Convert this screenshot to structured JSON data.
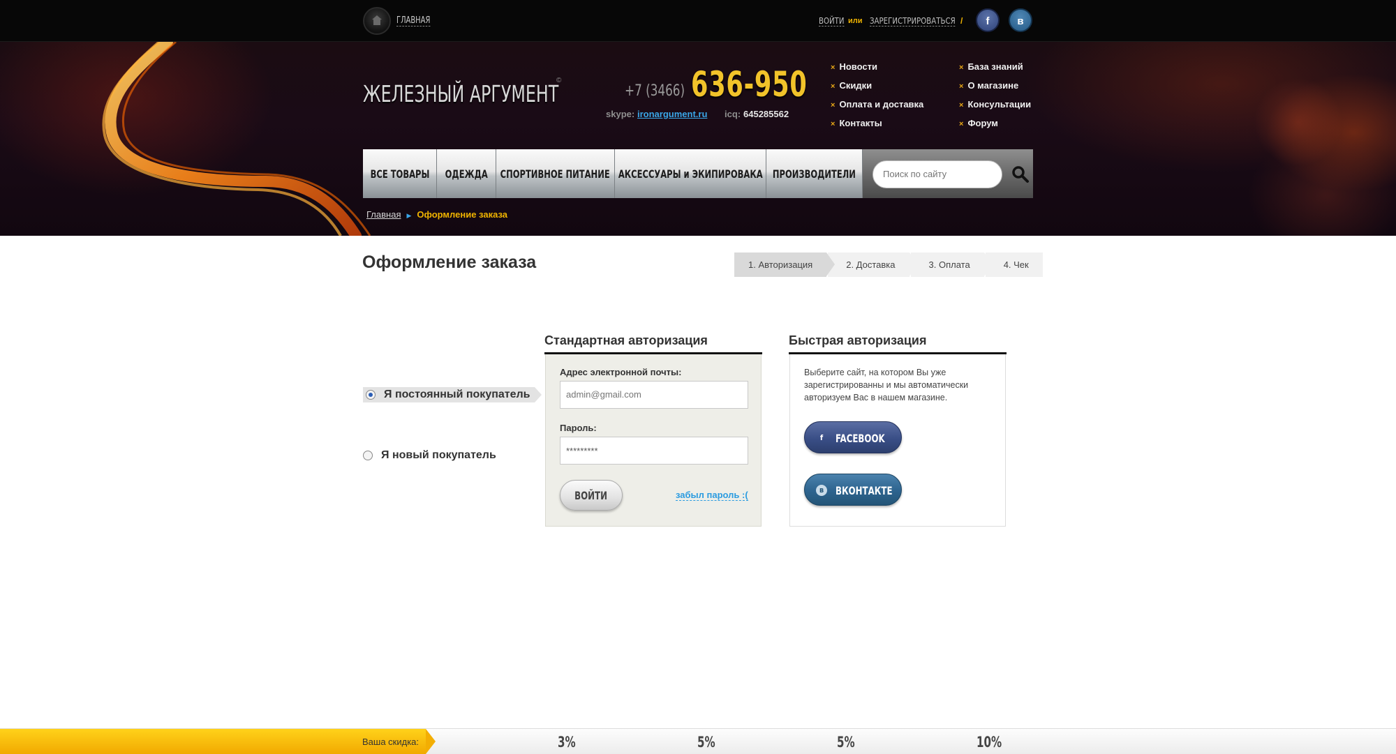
{
  "topbar": {
    "home_label": "ГЛАВНАЯ",
    "login_label": "ВОЙТИ",
    "or_label": "или",
    "register_label": "ЗАРЕГИСТРИРОВАТЬСЯ",
    "slash": "/",
    "facebook_glyph": "f",
    "vk_glyph": "в"
  },
  "header": {
    "logo": "ЖЕЛЕЗНЫЙ АРГУМЕНТ",
    "logo_reg": "©",
    "phone_code": "+7 (3466)",
    "phone_number": "636-950",
    "skype_label": "skype:",
    "skype_value": "ironargument.ru",
    "icq_label": "icq:",
    "icq_value": "645285562",
    "nav_col1": [
      "Новости",
      "Скидки",
      "Оплата и доставка",
      "Контакты"
    ],
    "nav_col2": [
      "База знаний",
      "О магазине",
      "Консультации",
      "Форум"
    ],
    "nav_marker": "×"
  },
  "menu": {
    "items": [
      "ВСЕ ТОВАРЫ",
      "ОДЕЖДА",
      "СПОРТИВНОЕ ПИТАНИЕ",
      "АКСЕССУАРЫ и ЭКИПИРОВАКА",
      "ПРОИЗВОДИТЕЛИ"
    ],
    "search_placeholder": "Поиск по сайту"
  },
  "breadcrumb": {
    "home": "Главная",
    "arrow": "▶",
    "current": "Оформление заказа"
  },
  "page": {
    "title": "Оформление заказа",
    "steps": [
      "1. Авторизация",
      "2. Доставка",
      "3. Оплата",
      "4. Чек"
    ],
    "active_step": 0
  },
  "customer_type": {
    "returning": "Я постоянный покупатель",
    "new": "Я новый покупатель",
    "selected": "returning"
  },
  "standard_auth": {
    "title": "Стандартная авторизация",
    "email_label": "Адрес электронной почты:",
    "email_placeholder": "admin@gmail.com",
    "password_label": "Пароль:",
    "password_value": "*********",
    "login_button": "ВОЙТИ",
    "forgot_link": "забыл пароль :("
  },
  "fast_auth": {
    "title": "Быстрая авторизация",
    "description": "Выберите сайт, на котором Вы уже зарегистрированны и мы автоматически авторизуем Вас в нашем магазине.",
    "facebook_button": "FACEBOOK",
    "facebook_glyph": "f",
    "vk_button": "ВКОНТАКТЕ",
    "vk_glyph": "в"
  },
  "discount": {
    "label": "Ваша скидка:",
    "values": [
      "3%",
      "5%",
      "5%",
      "10%"
    ]
  },
  "colors": {
    "accent_yellow": "#f2c32a",
    "link_blue": "#2a9be0",
    "facebook": "#394e86",
    "vk": "#2d638e"
  }
}
